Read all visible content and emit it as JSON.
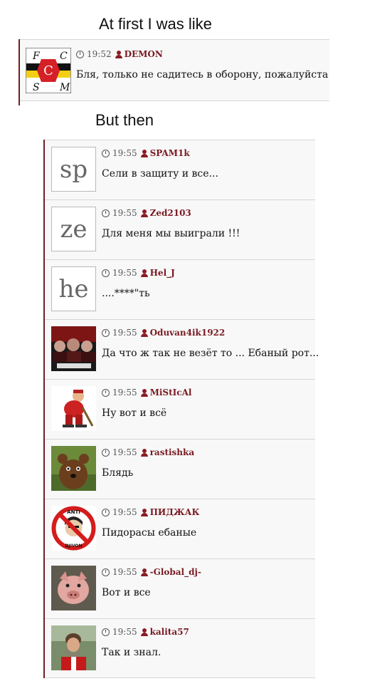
{
  "captions": {
    "first": "At first I was like",
    "second": "But then"
  },
  "thread1": {
    "comments": [
      {
        "time": "19:52",
        "user": "DEMON",
        "text": "Бля, только не садитесь в оборону, пожалуйста",
        "avatar": "fc-spartak-logo",
        "avatar_letters": [
          "F",
          "C",
          "S",
          "M",
          "C"
        ]
      }
    ]
  },
  "thread2": {
    "comments": [
      {
        "time": "19:55",
        "user": "SPAM1k",
        "text": "Сели в защиту и все...",
        "avatar_letters": "sp"
      },
      {
        "time": "19:55",
        "user": "Zed2103",
        "text": "Для меня мы выиграли !!!",
        "avatar_letters": "ze"
      },
      {
        "time": "19:55",
        "user": "Hel_J",
        "text": "....****\"ть",
        "avatar_letters": "he"
      },
      {
        "time": "19:55",
        "user": "Oduvan4ik1922",
        "text": "Да что ж так не везёт то ... Ебаный рот...",
        "avatar": "band-photo-avatar"
      },
      {
        "time": "19:55",
        "user": "MiStIcAl",
        "text": "Ну вот и всё",
        "avatar": "hockey-player-cartoon-avatar"
      },
      {
        "time": "19:55",
        "user": "rastishka",
        "text": "Блядь",
        "avatar": "cartoon-bear-avatar"
      },
      {
        "time": "19:55",
        "user": "ПИДЖАК",
        "text": "Пидорасы ебаные",
        "avatar": "anti-sign-avatar",
        "avatar_letters": [
          "ANTI",
          "DJIVON"
        ]
      },
      {
        "time": "19:55",
        "user": "-Global_dj-",
        "text": "Вот и все",
        "avatar": "pig-photo-avatar"
      },
      {
        "time": "19:55",
        "user": "kalita57",
        "text": "Так и знал.",
        "avatar": "bearded-man-avatar"
      }
    ]
  }
}
